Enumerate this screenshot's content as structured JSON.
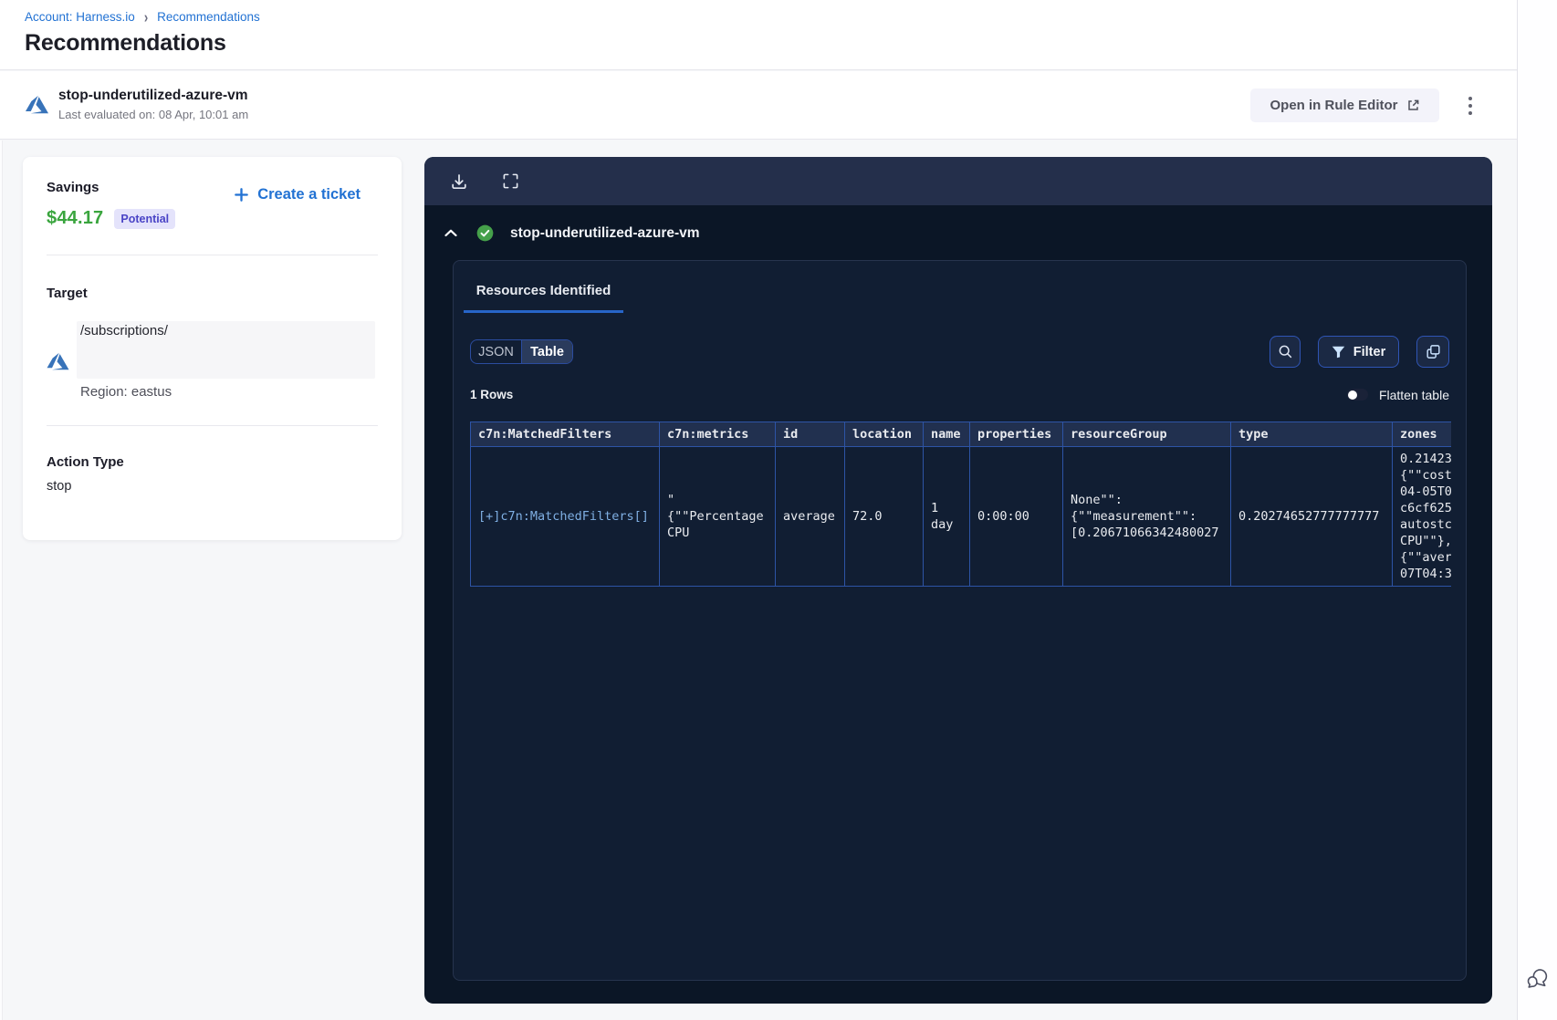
{
  "breadcrumb": {
    "account": "Account: Harness.io",
    "separator": "›",
    "current": "Recommendations"
  },
  "page": {
    "title": "Recommendations"
  },
  "rule_header": {
    "name": "stop-underutilized-azure-vm",
    "last_evaluated": "Last evaluated on: 08 Apr, 10:01 am",
    "open_in_rule_editor": "Open in Rule Editor"
  },
  "savings_card": {
    "savings_label": "Savings",
    "create_ticket": "Create a ticket",
    "amount": "$44.17",
    "badge": "Potential",
    "target_label": "Target",
    "target_path": "/subscriptions/",
    "region": "Region: eastus",
    "action_type_label": "Action Type",
    "action_type_value": "stop"
  },
  "panel": {
    "title": "stop-underutilized-azure-vm",
    "tab": "Resources Identified",
    "view_toggle": {
      "json": "JSON",
      "table": "Table"
    },
    "filter_label": "Filter",
    "rows_count": "1 Rows",
    "flatten_label": "Flatten table"
  },
  "table": {
    "columns": [
      "c7n:MatchedFilters",
      "c7n:metrics",
      "id",
      "location",
      "name",
      "properties",
      "resourceGroup",
      "type",
      "zones"
    ],
    "row": [
      "[+]c7n:MatchedFilters[]",
      "\"\n{\"\"Percentage\nCPU",
      "average",
      "72.0",
      "1\nday",
      "0:00:00",
      "None\"\":\n{\"\"measurement\"\":\n[0.20671066342480027",
      "0.20274652777777777",
      "0.21423\n{\"\"cost\n04-05T0\nc6cf625\nautostc\nCPU\"\"},\n{\"\"aver\n07T04:3"
    ]
  },
  "colors": {
    "accent_blue": "#2272D3",
    "savings_green": "#3AA53E",
    "badge_bg": "#E4E3FB",
    "badge_text": "#4A44C6",
    "panel_bg": "#0B1626",
    "table_border": "#2D54A6",
    "azure_blue": "#3873B9",
    "check_green": "#45A04A"
  }
}
